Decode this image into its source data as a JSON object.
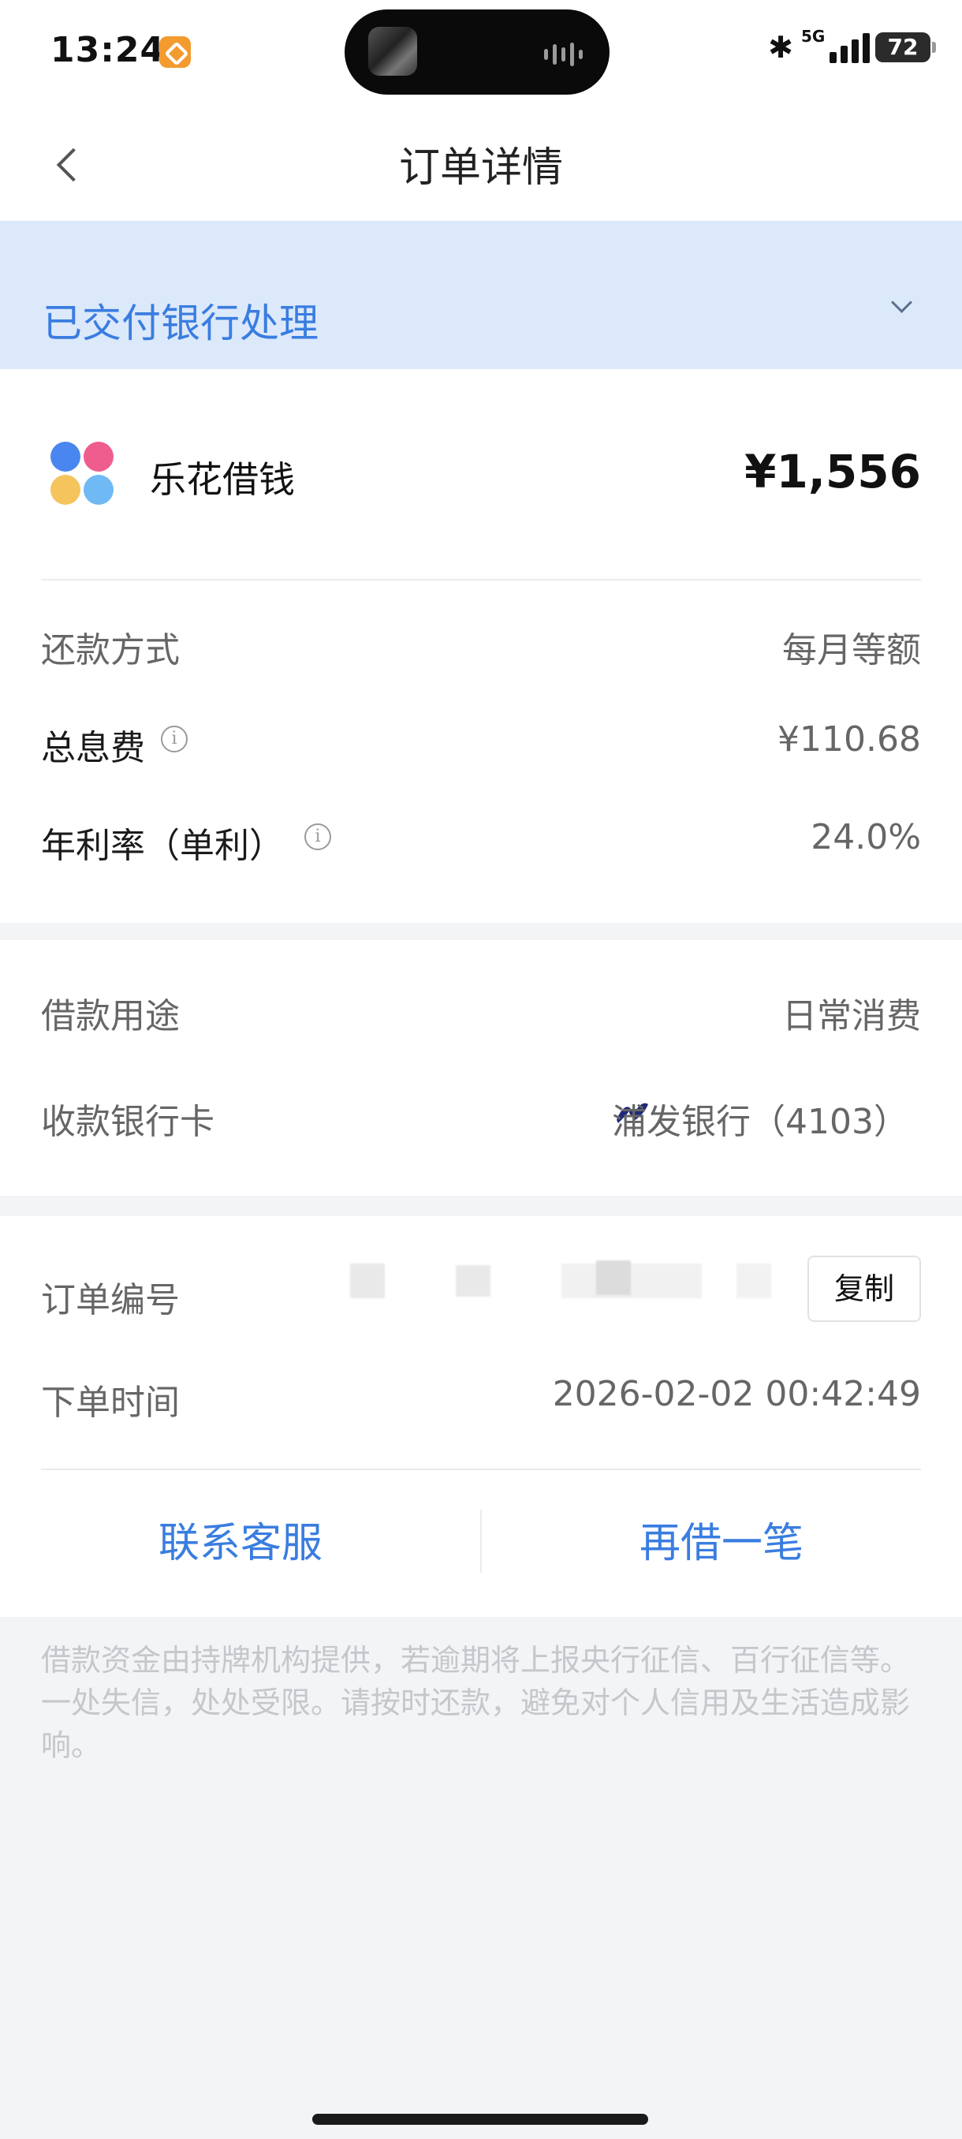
{
  "status_bar": {
    "time": "13:24",
    "network": "5G",
    "battery": "72"
  },
  "nav": {
    "title": "订单详情"
  },
  "banner": {
    "status_text": "已交付银行处理"
  },
  "product": {
    "name": "乐花借钱",
    "amount": "¥1,556"
  },
  "loan_details": [
    {
      "label": "还款方式",
      "value": "每月等额"
    },
    {
      "label": "总息费",
      "value": "¥110.68"
    },
    {
      "label": "年利率（单利）",
      "value": "24.0%"
    }
  ],
  "usage": {
    "label": "借款用途",
    "value": "日常消费"
  },
  "bank_card": {
    "label": "收款银行卡",
    "value": "浦发银行（4103）"
  },
  "order": {
    "number_label": "订单编号",
    "copy_label": "复制",
    "time_label": "下单时间",
    "time_value": "2026-02-02 00:42:49"
  },
  "actions": {
    "contact": "联系客服",
    "borrow_again": "再借一笔"
  },
  "notice": "借款资金由持牌机构提供，若逾期将上报央行征信、百行征信等。一处失信，处处受限。请按时还款，避免对个人信用及生活造成影响。",
  "colors": {
    "accent": "#3a7de0",
    "banner_bg": "#dce9fb",
    "bank_logo": "#1e2a78"
  },
  "icons": {
    "back": "chevron-left-icon",
    "expand": "chevron-down-icon",
    "info": "info-icon",
    "bank": "spdb-logo-icon",
    "product": "flower-logo-icon"
  }
}
